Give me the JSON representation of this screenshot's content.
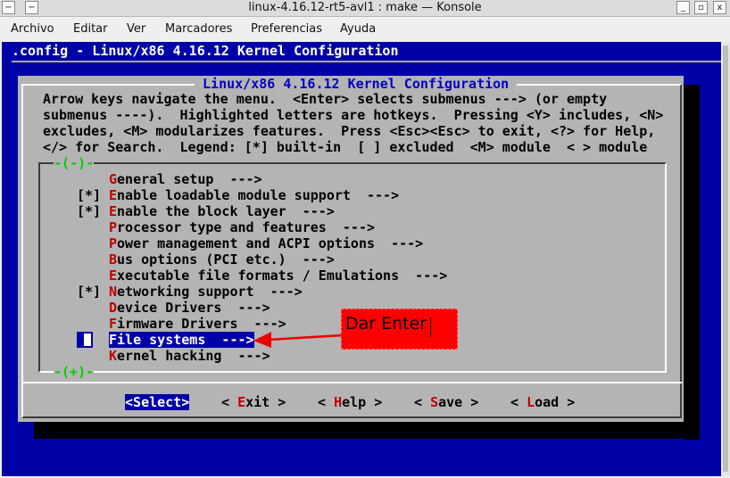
{
  "window": {
    "title": "linux-4.16.12-rt5-avl1 : make — Konsole",
    "menu_glyph": "−",
    "min_glyph": "_",
    "max_glyph": "▫",
    "close_glyph": "x"
  },
  "menubar": [
    "Archivo",
    "Editar",
    "Ver",
    "Marcadores",
    "Preferencias",
    "Ayuda"
  ],
  "config_title": ".config - Linux/x86 4.16.12 Kernel Configuration",
  "dialog": {
    "title": " Linux/x86 4.16.12 Kernel Configuration ",
    "help_lines": [
      "Arrow keys navigate the menu.  <Enter> selects submenus ---> (or empty",
      "submenus ----).  Highlighted letters are hotkeys.  Pressing <Y> includes, <N>",
      "excludes, <M> modularizes features.  Press <Esc><Esc> to exit, <?> for Help,",
      "</> for Search.  Legend: [*] built-in  [ ] excluded  <M> module  < > module"
    ],
    "more_above": "-(-)-",
    "more_below": "-(+)-"
  },
  "menu": [
    {
      "prefix": "",
      "hotkey": "G",
      "rest": "eneral setup  --->"
    },
    {
      "prefix": "[*]",
      "hotkey": "E",
      "rest": "nable loadable module support  --->"
    },
    {
      "prefix": "[*]",
      "hotkey": "E",
      "rest": "nable the block layer  --->"
    },
    {
      "prefix": "",
      "hotkey": "P",
      "rest": "rocessor type and features  --->"
    },
    {
      "prefix": "",
      "hotkey": "P",
      "rest": "ower management and ACPI options  --->"
    },
    {
      "prefix": "",
      "hotkey": "B",
      "rest": "us options (PCI etc.)  --->"
    },
    {
      "prefix": "",
      "hotkey": "E",
      "rest": "xecutable file formats / Emulations  --->"
    },
    {
      "prefix": "[*]",
      "hotkey": "N",
      "rest": "etworking support  --->"
    },
    {
      "prefix": "",
      "hotkey": "D",
      "rest": "evice Drivers  --->"
    },
    {
      "prefix": "",
      "hotkey": "F",
      "rest": "irmware Drivers  --->"
    },
    {
      "prefix": "",
      "hotkey": "F",
      "rest": "ile systems  --->",
      "selected": true
    },
    {
      "prefix": "",
      "hotkey": "K",
      "rest": "ernel hacking  --->"
    }
  ],
  "buttons": [
    {
      "open": "<",
      "hotkey": "S",
      "rest": "elect",
      "close": ">",
      "active": true
    },
    {
      "open": "< ",
      "hotkey": "E",
      "rest": "xit",
      "close": " >"
    },
    {
      "open": "< ",
      "hotkey": "H",
      "rest": "elp",
      "close": " >"
    },
    {
      "open": "< ",
      "hotkey": "S",
      "rest": "ave",
      "close": " >"
    },
    {
      "open": "< ",
      "hotkey": "L",
      "rest": "oad",
      "close": " >"
    }
  ],
  "annotation": {
    "text": "Dar Enter",
    "color": "#ff0000"
  },
  "colors": {
    "terminal_bg": "#0000a8",
    "dialog_bg": "#b4b4b4",
    "hotkey": "#c00000",
    "title_text": "#0000c8"
  }
}
